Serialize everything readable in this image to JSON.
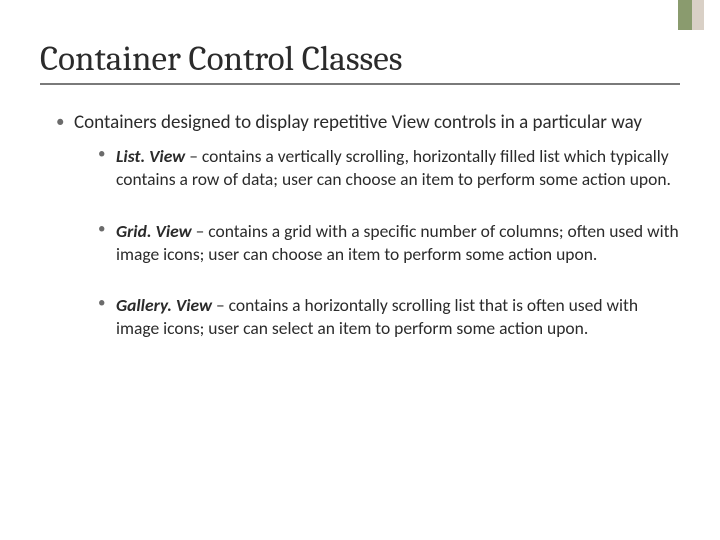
{
  "title": "Container Control Classes",
  "intro": "Containers designed to display repetitive View controls in a particular way",
  "items": [
    {
      "term": "List. View",
      "desc": " – contains a vertically scrolling, horizontally filled list which typically contains a row of data;  user can choose an item to perform some action upon."
    },
    {
      "term": "Grid. View",
      "desc": " – contains a grid with a specific number of columns; often used with image icons; user can choose an item to perform some action upon."
    },
    {
      "term": "Gallery. View",
      "desc": " – contains a horizontally scrolling list that is often used with image icons;  user can select an item to perform some action upon."
    }
  ]
}
